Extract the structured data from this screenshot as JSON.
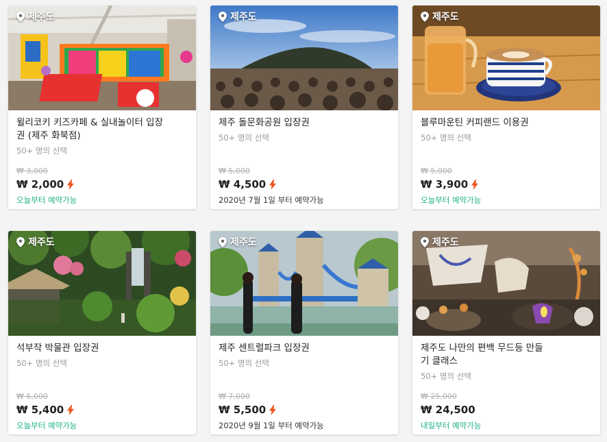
{
  "icons": {
    "location": "map-pin-icon",
    "instant": "lightning-bolt-icon"
  },
  "colors": {
    "available": "#1fb18c",
    "bolt": "#f0521e",
    "strike": "#b0b0b0"
  },
  "products": [
    {
      "location": "제주도",
      "title": "윌리코키 키즈카페 & 실내놀이터 입장권 (제주 화북점)",
      "subtitle": "50+ 명의 선택",
      "original_price": "₩ 3,000",
      "price": "₩ 2,000",
      "instant": true,
      "availability": "오늘부터 예약가능",
      "availability_color": "green"
    },
    {
      "location": "제주도",
      "title": "제주 돌문화공원 입장권",
      "subtitle": "50+ 명의 선택",
      "original_price": "₩ 5,000",
      "price": "₩ 4,500",
      "instant": true,
      "availability": "2020년 7월 1일 부터 예약가능",
      "availability_color": "dark"
    },
    {
      "location": "제주도",
      "title": "블루마운틴 커피랜드 이용권",
      "subtitle": "50+ 명의 선택",
      "original_price": "₩ 5,000",
      "price": "₩ 3,900",
      "instant": true,
      "availability": "오늘부터 예약가능",
      "availability_color": "green"
    },
    {
      "location": "제주도",
      "title": "석부작 박물관 입장권",
      "subtitle": "50+ 명의 선택",
      "original_price": "₩ 6,000",
      "price": "₩ 5,400",
      "instant": true,
      "availability": "오늘부터 예약가능",
      "availability_color": "green"
    },
    {
      "location": "제주도",
      "title": "제주 센트럴파크 입장권",
      "subtitle": "50+ 명의 선택",
      "original_price": "₩ 7,000",
      "price": "₩ 5,500",
      "instant": true,
      "availability": "2020년 9월 1일 부터 예약가능",
      "availability_color": "dark"
    },
    {
      "location": "제주도",
      "title": "제주도 나만의 편백 무드등 만들기 클래스",
      "subtitle": "50+ 명의 선택",
      "original_price": "₩ 25,000",
      "price": "₩ 24,500",
      "instant": false,
      "availability": "내일부터 예약가능",
      "availability_color": "green"
    }
  ]
}
